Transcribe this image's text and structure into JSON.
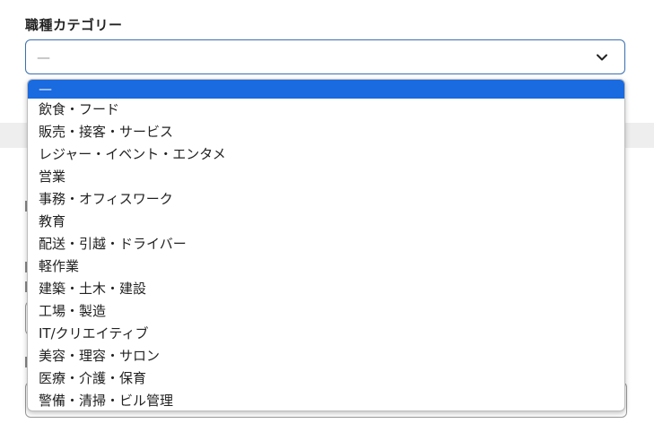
{
  "field": {
    "label": "職種カテゴリー",
    "selected_value": "—"
  },
  "dropdown": {
    "options": [
      {
        "label": "—",
        "selected": true
      },
      {
        "label": "飲食・フード",
        "selected": false
      },
      {
        "label": "販売・接客・サービス",
        "selected": false
      },
      {
        "label": "レジャー・イベント・エンタメ",
        "selected": false
      },
      {
        "label": "営業",
        "selected": false
      },
      {
        "label": "事務・オフィスワーク",
        "selected": false
      },
      {
        "label": "教育",
        "selected": false
      },
      {
        "label": "配送・引越・ドライバー",
        "selected": false
      },
      {
        "label": "軽作業",
        "selected": false
      },
      {
        "label": "建築・土木・建設",
        "selected": false
      },
      {
        "label": "工場・製造",
        "selected": false
      },
      {
        "label": "IT/クリエイティブ",
        "selected": false
      },
      {
        "label": "美容・理容・サロン",
        "selected": false
      },
      {
        "label": "医療・介護・保育",
        "selected": false
      },
      {
        "label": "警備・清掃・ビル管理",
        "selected": false
      }
    ]
  },
  "icons": {
    "select_arrow": "chevron-down-icon"
  },
  "colors": {
    "highlight": "#1a6ae0",
    "select_border": "#3a6fb0"
  }
}
